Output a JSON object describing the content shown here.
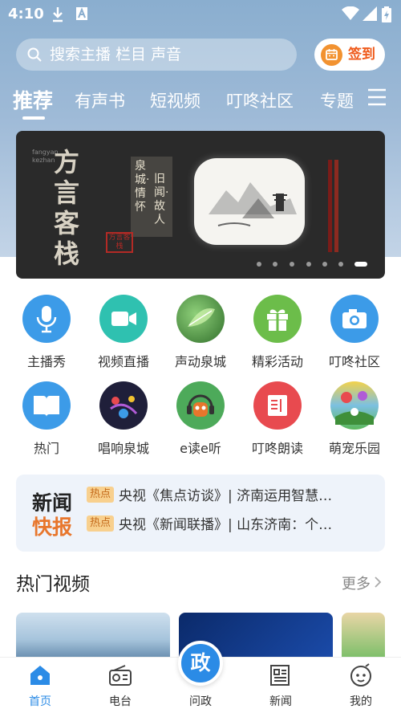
{
  "status": {
    "time": "4:10"
  },
  "search": {
    "placeholder": "搜索主播 栏目 声音"
  },
  "signin": {
    "label": "签到"
  },
  "tabs": [
    {
      "label": "推荐",
      "active": true
    },
    {
      "label": "有声书"
    },
    {
      "label": "短视频"
    },
    {
      "label": "叮咚社区"
    },
    {
      "label": "专题"
    }
  ],
  "banner": {
    "title": "方言客栈",
    "pinyin": "fangyan kezhan",
    "vertical1": "泉城·情怀",
    "vertical2": "旧闻·故人",
    "seal": "方言客栈",
    "slides": 7,
    "active_slide": 7
  },
  "grid": [
    {
      "label": "主播秀",
      "icon": "microphone-icon",
      "color": "#3c9be8"
    },
    {
      "label": "视频直播",
      "icon": "video-camera-icon",
      "color": "#2fc1b0"
    },
    {
      "label": "声动泉城",
      "icon": "leaf-image-icon",
      "color": "#3f8f3a"
    },
    {
      "label": "精彩活动",
      "icon": "gift-icon",
      "color": "#6cbd4a"
    },
    {
      "label": "叮咚社区",
      "icon": "camera-icon",
      "color": "#3c9be8"
    },
    {
      "label": "热门",
      "icon": "book-icon",
      "color": "#3c9be8"
    },
    {
      "label": "唱响泉城",
      "icon": "sing-logo-icon",
      "color": "#1f1f3a"
    },
    {
      "label": "e读e听",
      "icon": "headphones-owl-icon",
      "color": "#4daa5a"
    },
    {
      "label": "叮咚朗读",
      "icon": "open-book-icon",
      "color": "#e84a4f"
    },
    {
      "label": "萌宠乐园",
      "icon": "cartoon-scene-icon",
      "color": "#7cc0e0"
    }
  ],
  "news": {
    "title_line1": "新闻",
    "title_line2": "快报",
    "items": [
      {
        "tag": "热点",
        "text": "央视《焦点访谈》| 济南运用智慧…"
      },
      {
        "tag": "热点",
        "text": "央视《新闻联播》| 山东济南：个…"
      }
    ]
  },
  "hot_videos": {
    "title": "热门视频",
    "more": "更多"
  },
  "bottom_nav": [
    {
      "label": "首页",
      "icon": "home-icon",
      "active": true
    },
    {
      "label": "电台",
      "icon": "radio-icon"
    },
    {
      "label": "问政",
      "icon": "gov-icon",
      "badge": "政"
    },
    {
      "label": "新闻",
      "icon": "newspaper-icon"
    },
    {
      "label": "我的",
      "icon": "face-icon"
    }
  ],
  "colors": {
    "accent": "#2b8be6",
    "orange": "#e8762c",
    "signin": "#ef5a1b"
  }
}
